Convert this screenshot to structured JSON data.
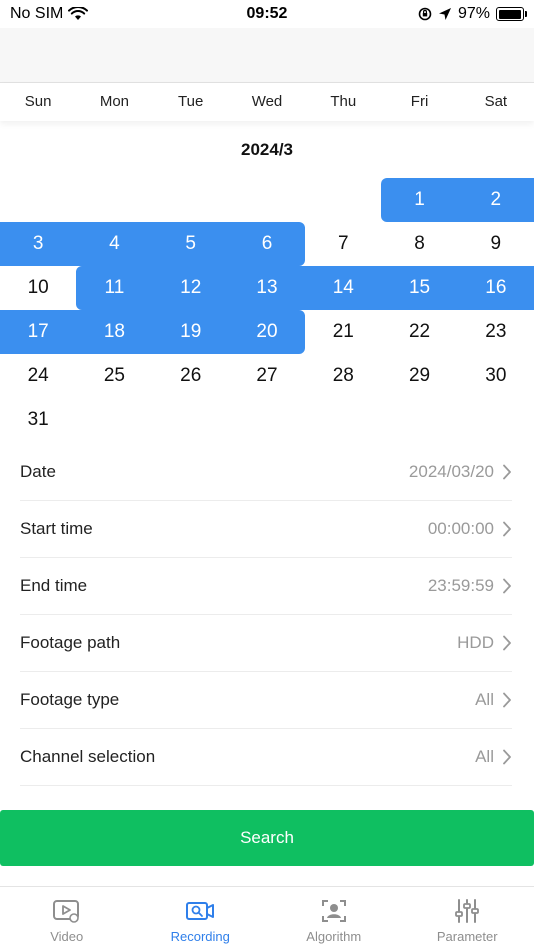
{
  "status_bar": {
    "carrier": "No SIM",
    "time": "09:52",
    "battery_percent": "97%",
    "battery_level": 0.97
  },
  "calendar": {
    "weekdays": [
      "Sun",
      "Mon",
      "Tue",
      "Wed",
      "Thu",
      "Fri",
      "Sat"
    ],
    "month_label": "2024/3",
    "first_weekday_index": 5,
    "days": [
      "1",
      "2",
      "3",
      "4",
      "5",
      "6",
      "7",
      "8",
      "9",
      "10",
      "11",
      "12",
      "13",
      "14",
      "15",
      "16",
      "17",
      "18",
      "19",
      "20",
      "21",
      "22",
      "23",
      "24",
      "25",
      "26",
      "27",
      "28",
      "29",
      "30",
      "31"
    ],
    "selected_days": [
      1,
      2,
      3,
      4,
      5,
      6,
      11,
      12,
      13,
      14,
      15,
      16,
      17,
      18,
      19,
      20
    ],
    "selected_color": "#3b8fef"
  },
  "form": {
    "rows": [
      {
        "label": "Date",
        "value": "2024/03/20"
      },
      {
        "label": "Start time",
        "value": "00:00:00"
      },
      {
        "label": "End time",
        "value": "23:59:59"
      },
      {
        "label": "Footage path",
        "value": "HDD"
      },
      {
        "label": "Footage type",
        "value": "All"
      },
      {
        "label": "Channel selection",
        "value": "All"
      }
    ]
  },
  "search_button": {
    "label": "Search",
    "color": "#0fbf61"
  },
  "tab_bar": {
    "tabs": [
      {
        "label": "Video",
        "icon": "video-play-icon"
      },
      {
        "label": "Recording",
        "icon": "recording-search-icon"
      },
      {
        "label": "Algorithm",
        "icon": "face-scan-icon"
      },
      {
        "label": "Parameter",
        "icon": "sliders-icon"
      }
    ],
    "active_index": 1,
    "active_color": "#2f7fea"
  }
}
